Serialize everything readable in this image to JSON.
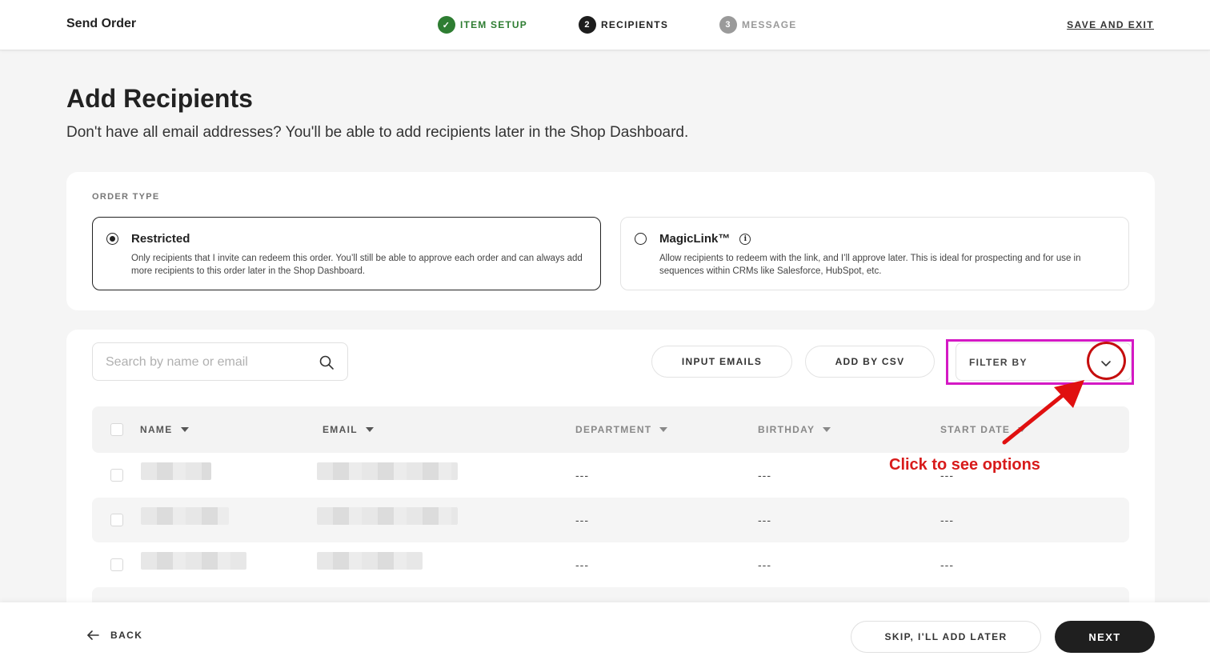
{
  "header": {
    "brand": "Send Order",
    "steps": [
      {
        "label": "ITEM SETUP",
        "marker": "✓",
        "state": "done"
      },
      {
        "label": "RECIPIENTS",
        "marker": "2",
        "state": "active"
      },
      {
        "label": "MESSAGE",
        "marker": "3",
        "state": "todo"
      }
    ],
    "save_exit": "SAVE AND EXIT"
  },
  "page": {
    "title": "Add Recipients",
    "subtitle": "Don't have all email addresses? You'll be able to add recipients later in the Shop Dashboard."
  },
  "order_type": {
    "label": "ORDER TYPE",
    "options": [
      {
        "title": "Restricted",
        "description": "Only recipients that I invite can redeem this order. You’ll still be able to approve each order and can always add more recipients to this order later in the Shop Dashboard.",
        "selected": true
      },
      {
        "title": "MagicLink™",
        "description": "Allow recipients to redeem with the link, and I’ll approve later. This is ideal for prospecting and for use in sequences within CRMs like Salesforce, HubSpot, etc.",
        "selected": false,
        "info_icon": "info-icon"
      }
    ]
  },
  "toolbar": {
    "search_placeholder": "Search by name or email",
    "search_value": "",
    "input_emails": "INPUT EMAILS",
    "add_by_csv": "ADD BY CSV",
    "filter_by": "FILTER BY"
  },
  "table": {
    "columns": [
      "NAME",
      "EMAIL",
      "DEPARTMENT",
      "BIRTHDAY",
      "START DATE"
    ],
    "rows": [
      {
        "name": "",
        "email": "",
        "department": "---",
        "birthday": "---",
        "start_date": "---"
      },
      {
        "name": "",
        "email": "",
        "department": "---",
        "birthday": "---",
        "start_date": "---"
      },
      {
        "name": "",
        "email": "",
        "department": "---",
        "birthday": "---",
        "start_date": "---"
      }
    ]
  },
  "annotation": {
    "text": "Click to see options",
    "box_color": "#d419c4",
    "arrow_color": "#e01010"
  },
  "footer": {
    "back": "BACK",
    "skip": "SKIP, I'LL ADD LATER",
    "next": "NEXT"
  }
}
